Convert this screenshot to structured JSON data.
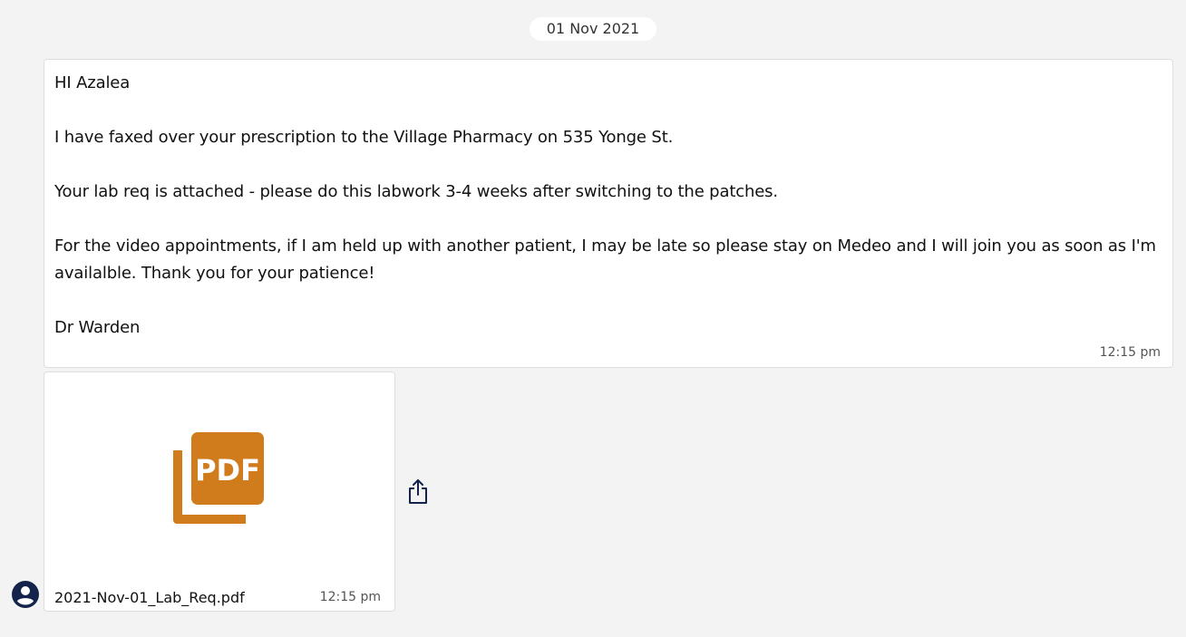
{
  "date_divider": "01 Nov 2021",
  "message": {
    "greeting": "HI Azalea",
    "line1": "I have faxed over your prescription to the Village Pharmacy on 535 Yonge St.",
    "line2": "Your lab req is attached - please do this labwork 3-4 weeks after switching to the patches.",
    "line3a": "For the video appointments, if I am held up with another patient, I may be late so please stay on Medeo and I will join you as soon as I'm",
    "line3b": "availalble. Thank you for your patience!",
    "signature": "Dr Warden",
    "time": "12:15 pm"
  },
  "attachment": {
    "icon_label": "PDF",
    "file_name": "2021-Nov-01_Lab_Req.pdf",
    "time": "12:15 pm",
    "icon_color": "#d07b1c"
  },
  "icons": {
    "share": "share-icon",
    "avatar": "user-avatar-icon"
  },
  "colors": {
    "background": "#f3f3f3",
    "card": "#ffffff",
    "avatar": "#14234b"
  }
}
